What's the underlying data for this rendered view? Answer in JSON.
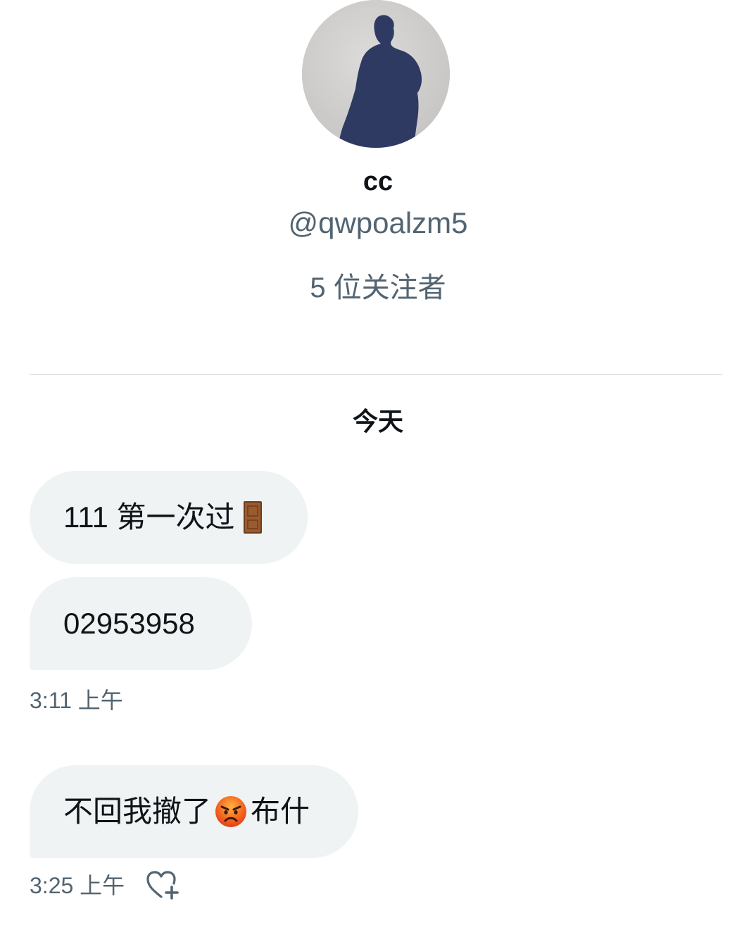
{
  "profile": {
    "display_name": "cc",
    "handle": "@qwpoalzm5",
    "followers": "5 位关注者"
  },
  "conversation": {
    "day_label": "今天",
    "messages": [
      {
        "text": "111 第一次过",
        "emoji": "door-emoji"
      },
      {
        "text": "02953958"
      },
      {
        "text_before": "不回我撤了",
        "emoji": "angry-face-emoji",
        "text_after": "布什"
      }
    ],
    "timestamps": [
      "3:11 上午",
      "3:25 上午"
    ]
  },
  "icons": {
    "reaction": "heart-plus-icon"
  }
}
